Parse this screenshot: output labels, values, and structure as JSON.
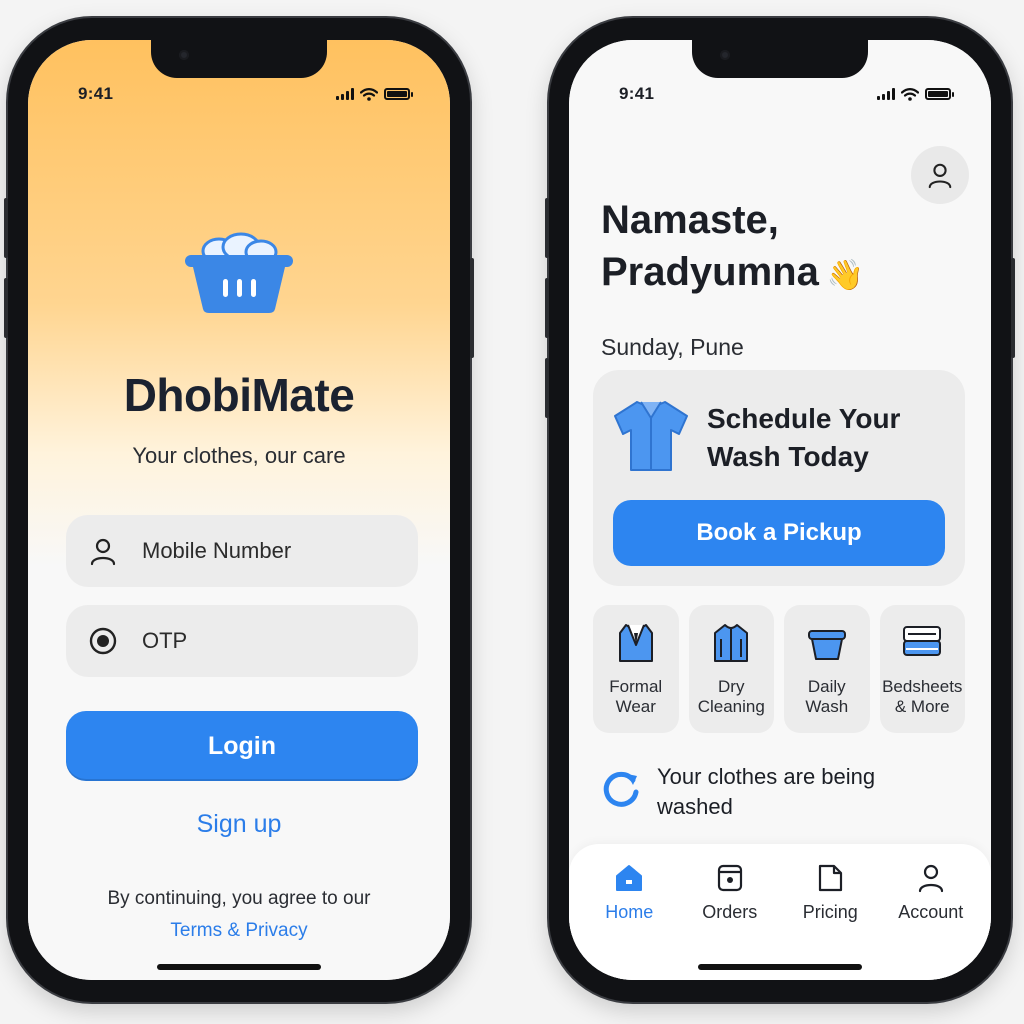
{
  "colors": {
    "accent": "#2d85f0",
    "link": "#2b7de9",
    "header_gradient": "#ffc15f",
    "card_bg": "#ececec",
    "text": "#1c1f26"
  },
  "login_screen": {
    "status": {
      "time": "9:41"
    },
    "logo_icon": "laundry-basket-icon",
    "app_name": "DhobiMate",
    "tagline": "Your clothes, our care",
    "mobile_field": {
      "placeholder": "Mobile Number",
      "icon": "user-icon"
    },
    "otp_field": {
      "placeholder": "OTP",
      "icon": "radio-dot-icon"
    },
    "login_button": "Login",
    "signup_link": "Sign up",
    "agreement_text": "By continuing, you agree to our",
    "terms_link": "Terms & Privacy"
  },
  "home_screen": {
    "status": {
      "time": "9:41"
    },
    "profile_icon": "user-icon",
    "greeting_line1": "Namaste,",
    "greeting_line2": "Pradyumna",
    "greeting_emoji": "👋",
    "day_location": "Sunday, Pune",
    "schedule_card": {
      "icon": "shirt-icon",
      "title_line1": "Schedule Your",
      "title_line2": "Wash Today",
      "button": "Book a Pickup"
    },
    "services": [
      {
        "line1": "Formal",
        "line2": "Wear",
        "icon": "suit-icon"
      },
      {
        "line1": "Dry",
        "line2": "Cleaning",
        "icon": "jacket-icon"
      },
      {
        "line1": "Daily",
        "line2": "Wash",
        "icon": "basket-icon"
      },
      {
        "line1": "Bedsheets",
        "line2": "& More",
        "icon": "bedsheet-icon"
      }
    ],
    "wash_status": {
      "icon": "refresh-icon",
      "line1": "Your clothes are being",
      "line2": "washed"
    },
    "tabs": [
      {
        "label": "Home",
        "icon": "home-icon",
        "active": true
      },
      {
        "label": "Orders",
        "icon": "orders-icon",
        "active": false
      },
      {
        "label": "Pricing",
        "icon": "pricing-icon",
        "active": false
      },
      {
        "label": "Account",
        "icon": "account-icon",
        "active": false
      }
    ]
  }
}
